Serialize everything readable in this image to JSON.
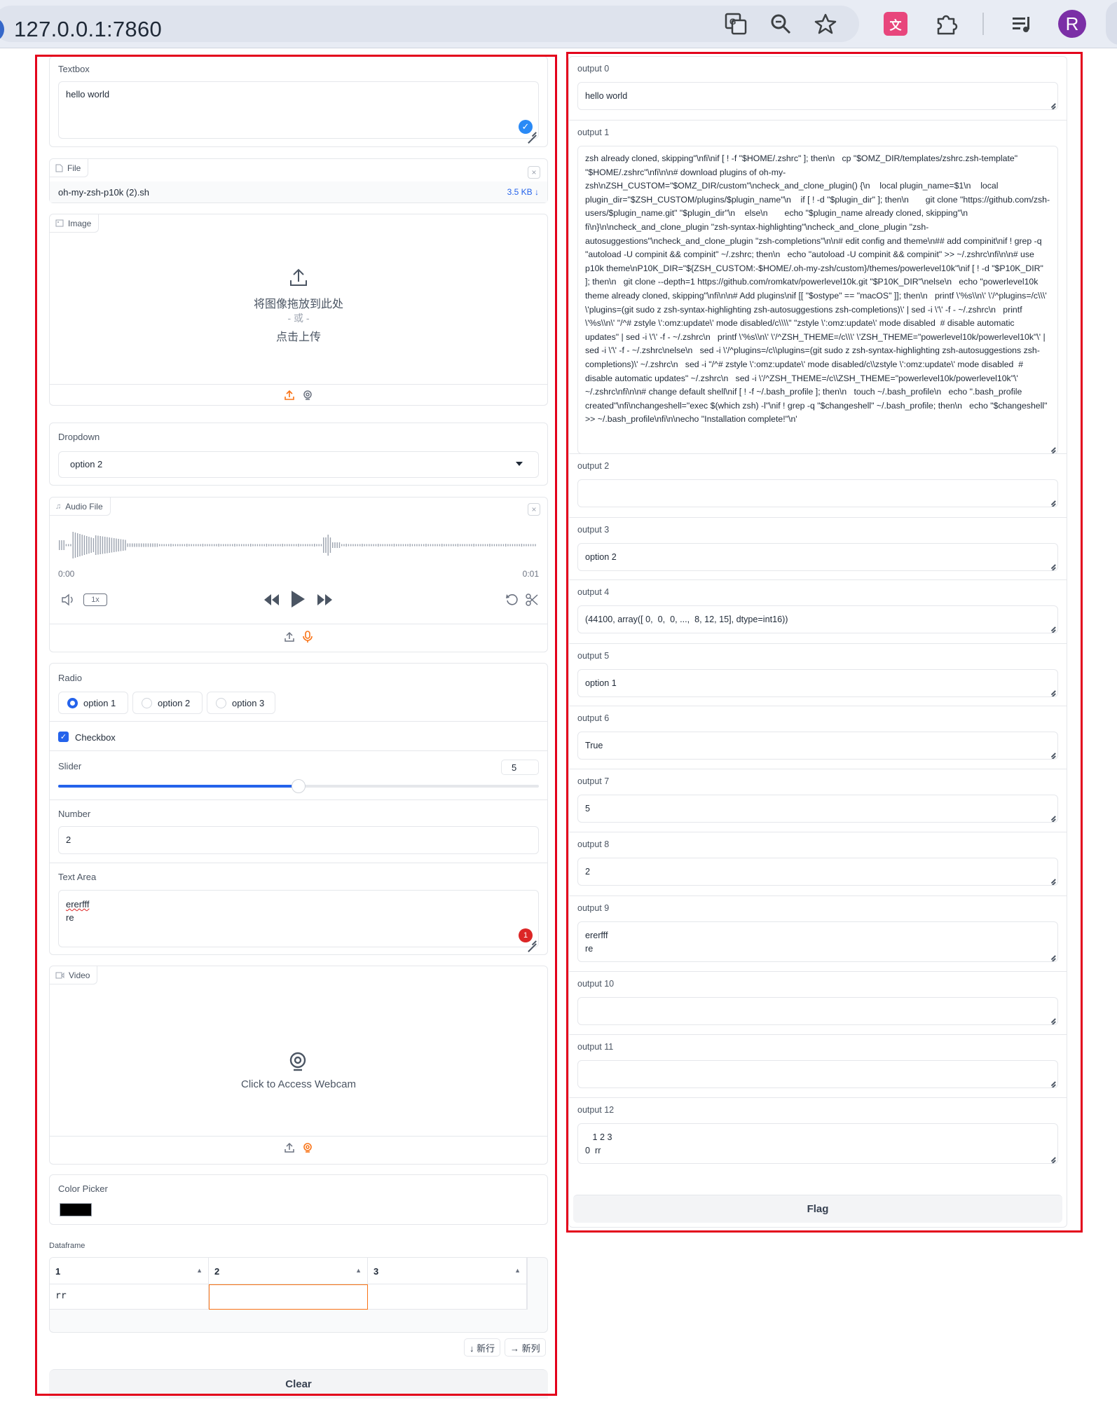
{
  "browser": {
    "url": "127.0.0.1:7860",
    "avatar_letter": "R"
  },
  "inputs": {
    "textbox": {
      "label": "Textbox",
      "value": "hello world"
    },
    "file": {
      "label": "File",
      "name": "oh-my-zsh-p10k (2).sh",
      "size": "3.5 KB ↓"
    },
    "image": {
      "label": "Image",
      "drop_text": "将图像拖放到此处",
      "or_text": "- 或 -",
      "click_text": "点击上传"
    },
    "dropdown": {
      "label": "Dropdown",
      "value": "option 2"
    },
    "audio": {
      "label": "Audio File",
      "time_start": "0:00",
      "time_end": "0:01",
      "speed": "1x"
    },
    "radio": {
      "label": "Radio",
      "options": [
        "option 1",
        "option 2",
        "option 3"
      ],
      "selected": 0
    },
    "checkbox": {
      "label": "Checkbox",
      "checked": true
    },
    "slider": {
      "label": "Slider",
      "value": "5",
      "fraction": 0.5
    },
    "number": {
      "label": "Number",
      "value": "2"
    },
    "textarea": {
      "label": "Text Area",
      "line1": "ererfff",
      "line2": "re",
      "badge": "1"
    },
    "video": {
      "label": "Video",
      "webcam_text": "Click to Access Webcam"
    },
    "color": {
      "label": "Color Picker",
      "value": "#000000"
    },
    "dataframe": {
      "label": "Dataframe",
      "headers": [
        "1",
        "2",
        "3"
      ],
      "cells": [
        "rr",
        "",
        ""
      ],
      "add_row": "↓ 新行",
      "add_col": "→ 新列"
    },
    "clear_label": "Clear"
  },
  "outputs": [
    {
      "label": "output 0",
      "value": "hello world"
    },
    {
      "label": "output 1",
      "value": "zsh already cloned, skipping\"\\nfi\\nif [ ! -f \"$HOME/.zshrc\" ]; then\\n   cp \"$OMZ_DIR/templates/zshrc.zsh-template\" \"$HOME/.zshrc\"\\nfi\\n\\n# download plugins of oh-my-zsh\\nZSH_CUSTOM=\"$OMZ_DIR/custom\"\\ncheck_and_clone_plugin() {\\n    local plugin_name=$1\\n    local plugin_dir=\"$ZSH_CUSTOM/plugins/$plugin_name\"\\n    if [ ! -d \"$plugin_dir\" ]; then\\n       git clone \"https://github.com/zsh-users/$plugin_name.git\" \"$plugin_dir\"\\n    else\\n       echo \"$plugin_name already cloned, skipping\"\\n    fi\\n}\\n\\ncheck_and_clone_plugin \"zsh-syntax-highlighting\"\\ncheck_and_clone_plugin \"zsh-autosuggestions\"\\ncheck_and_clone_plugin \"zsh-completions\"\\n\\n# edit config and theme\\n## add compinit\\nif ! grep -q \"autoload -U compinit && compinit\" ~/.zshrc; then\\n   echo \"autoload -U compinit && compinit\" >> ~/.zshrc\\nfi\\n\\n# use p10k theme\\nP10K_DIR=\"${ZSH_CUSTOM:-$HOME/.oh-my-zsh/custom}/themes/powerlevel10k\"\\nif [ ! -d \"$P10K_DIR\" ]; then\\n   git clone --depth=1 https://github.com/romkatv/powerlevel10k.git \"$P10K_DIR\"\\nelse\\n   echo \"powerlevel10k theme already cloned, skipping\"\\nfi\\n\\n# Add plugins\\nif [[ \"$ostype\" == \"macOS\" ]]; then\\n   printf \\'%s\\\\n\\' \\'/^plugins=/c\\\\\\' \\'plugins=(git sudo z zsh-syntax-highlighting zsh-autosuggestions zsh-completions)\\' | sed -i \\'\\' -f - ~/.zshrc\\n   printf \\'%s\\\\n\\' \"/^# zstyle \\':omz:update\\' mode disabled/c\\\\\\\\\" \"zstyle \\':omz:update\\' mode disabled  # disable automatic updates\" | sed -i \\'\\' -f - ~/.zshrc\\n   printf \\'%s\\\\n\\' \\'/^ZSH_THEME=/c\\\\\\' \\'ZSH_THEME=\"powerlevel10k/powerlevel10k\"\\' | sed -i \\'\\' -f - ~/.zshrc\\nelse\\n   sed -i \\'/^plugins=/c\\\\plugins=(git sudo z zsh-syntax-highlighting zsh-autosuggestions zsh-completions)\\' ~/.zshrc\\n   sed -i \"/^# zstyle \\':omz:update\\' mode disabled/c\\\\zstyle \\':omz:update\\' mode disabled  # disable automatic updates\" ~/.zshrc\\n   sed -i \\'/^ZSH_THEME=/c\\\\ZSH_THEME=\"powerlevel10k/powerlevel10k\"\\' ~/.zshrc\\nfi\\n\\n# change default shell\\nif [ ! -f ~/.bash_profile ]; then\\n   touch ~/.bash_profile\\n   echo \".bash_profile created\"\\nfi\\nchangeshell=\"exec $(which zsh) -l\"\\nif ! grep -q \"$changeshell\" ~/.bash_profile; then\\n   echo \"$changeshell\" >> ~/.bash_profile\\nfi\\n\\necho \"Installation complete!\"\\n'"
    },
    {
      "label": "output 2",
      "value": ""
    },
    {
      "label": "output 3",
      "value": "option 2"
    },
    {
      "label": "output 4",
      "value": "(44100, array([ 0,  0,  0, ...,  8, 12, 15], dtype=int16))"
    },
    {
      "label": "output 5",
      "value": "option 1"
    },
    {
      "label": "output 6",
      "value": "True"
    },
    {
      "label": "output 7",
      "value": "5"
    },
    {
      "label": "output 8",
      "value": "2"
    },
    {
      "label": "output 9",
      "value": "ererfff\nre"
    },
    {
      "label": "output 10",
      "value": ""
    },
    {
      "label": "output 11",
      "value": ""
    },
    {
      "label": "output 12",
      "value": "   1 2 3\n0  rr"
    }
  ],
  "flag_label": "Flag",
  "colors": {
    "accent": "#f97316",
    "blue": "#2563eb",
    "frame": "#e3001b"
  }
}
